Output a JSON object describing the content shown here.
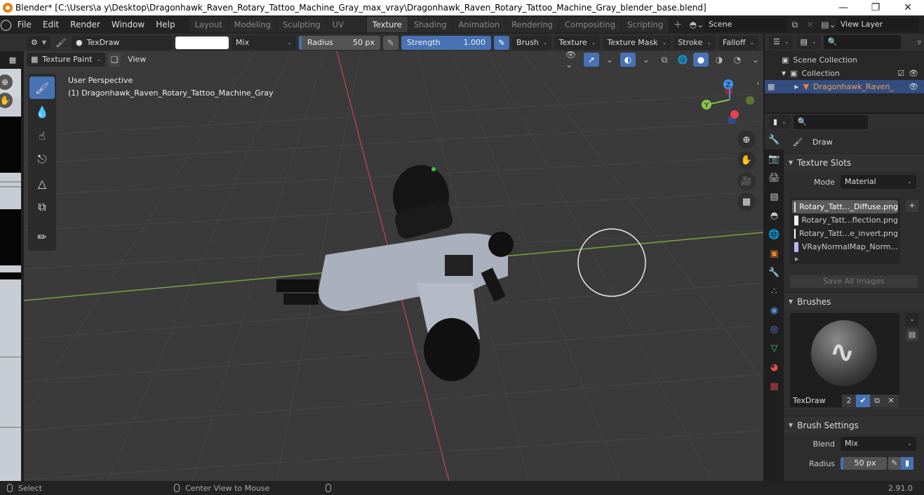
{
  "titlebar": {
    "title": "Blender* [C:\\Users\\a y\\Desktop\\Dragonhawk_Raven_Rotary_Tattoo_Machine_Gray_max_vray\\Dragonhawk_Raven_Rotary_Tattoo_Machine_Gray_blender_base.blend]",
    "minimize": "—",
    "maximize": "❐",
    "close": "✕"
  },
  "menu": {
    "items": [
      "File",
      "Edit",
      "Render",
      "Window",
      "Help"
    ],
    "workspaces": [
      "Layout",
      "Modeling",
      "Sculpting",
      "UV Editing",
      "Texture Paint",
      "Shading",
      "Animation",
      "Rendering",
      "Compositing",
      "Scripting"
    ],
    "active_workspace": "Texture Paint",
    "add": "+",
    "scene": "Scene",
    "view_layer": "View Layer"
  },
  "tool_header": {
    "brush_name": "TexDraw",
    "color_hex": "#ffffff",
    "blend": "Mix",
    "radius_label": "Radius",
    "radius_value": "50 px",
    "strength_label": "Strength",
    "strength_value": "1.000",
    "menus": [
      "Brush",
      "Texture",
      "Texture Mask",
      "Stroke",
      "Falloff"
    ]
  },
  "viewport_header": {
    "mode": "Texture Paint",
    "view": "View"
  },
  "viewport": {
    "perspective": "User Perspective",
    "object": "(1) Dragonhawk_Raven_Rotary_Tattoo_Machine_Gray",
    "gizmo": {
      "x": "X",
      "y": "Y",
      "z": "Z"
    },
    "colors": {
      "x_axis": "#e8414b",
      "y_axis": "#8bc34a",
      "z_axis": "#3f8ff0",
      "grid_bg": "#3a3a3a"
    }
  },
  "toolbox": {
    "tools": [
      "draw",
      "soften",
      "smear",
      "clone",
      "fill",
      "mask",
      "annotate"
    ],
    "active": "draw"
  },
  "outliner": {
    "scene_collection": "Scene Collection",
    "collection": "Collection",
    "object": "Dragonhawk_Raven_"
  },
  "properties": {
    "tool_name": "Draw",
    "texture_slots": {
      "title": "Texture Slots",
      "mode_label": "Mode",
      "mode_value": "Material",
      "slots": [
        "Rotary_Tatt..._Diffuse.png",
        "Rotary_Tatt...flection.png",
        "Rotary_Tatt...e_invert.png",
        "VRayNormalMap_Norm..."
      ],
      "selected_index": 0,
      "save_all": "Save All Images"
    },
    "brushes": {
      "title": "Brushes",
      "name": "TexDraw",
      "users": "2"
    },
    "brush_settings": {
      "title": "Brush Settings",
      "blend_label": "Blend",
      "blend_value": "Mix",
      "radius_label": "Radius",
      "radius_value": "50 px"
    }
  },
  "statusbar": {
    "left": "Select",
    "middle": "Center View to Mouse",
    "version": "2.91.0"
  },
  "accent": "#4772b3"
}
